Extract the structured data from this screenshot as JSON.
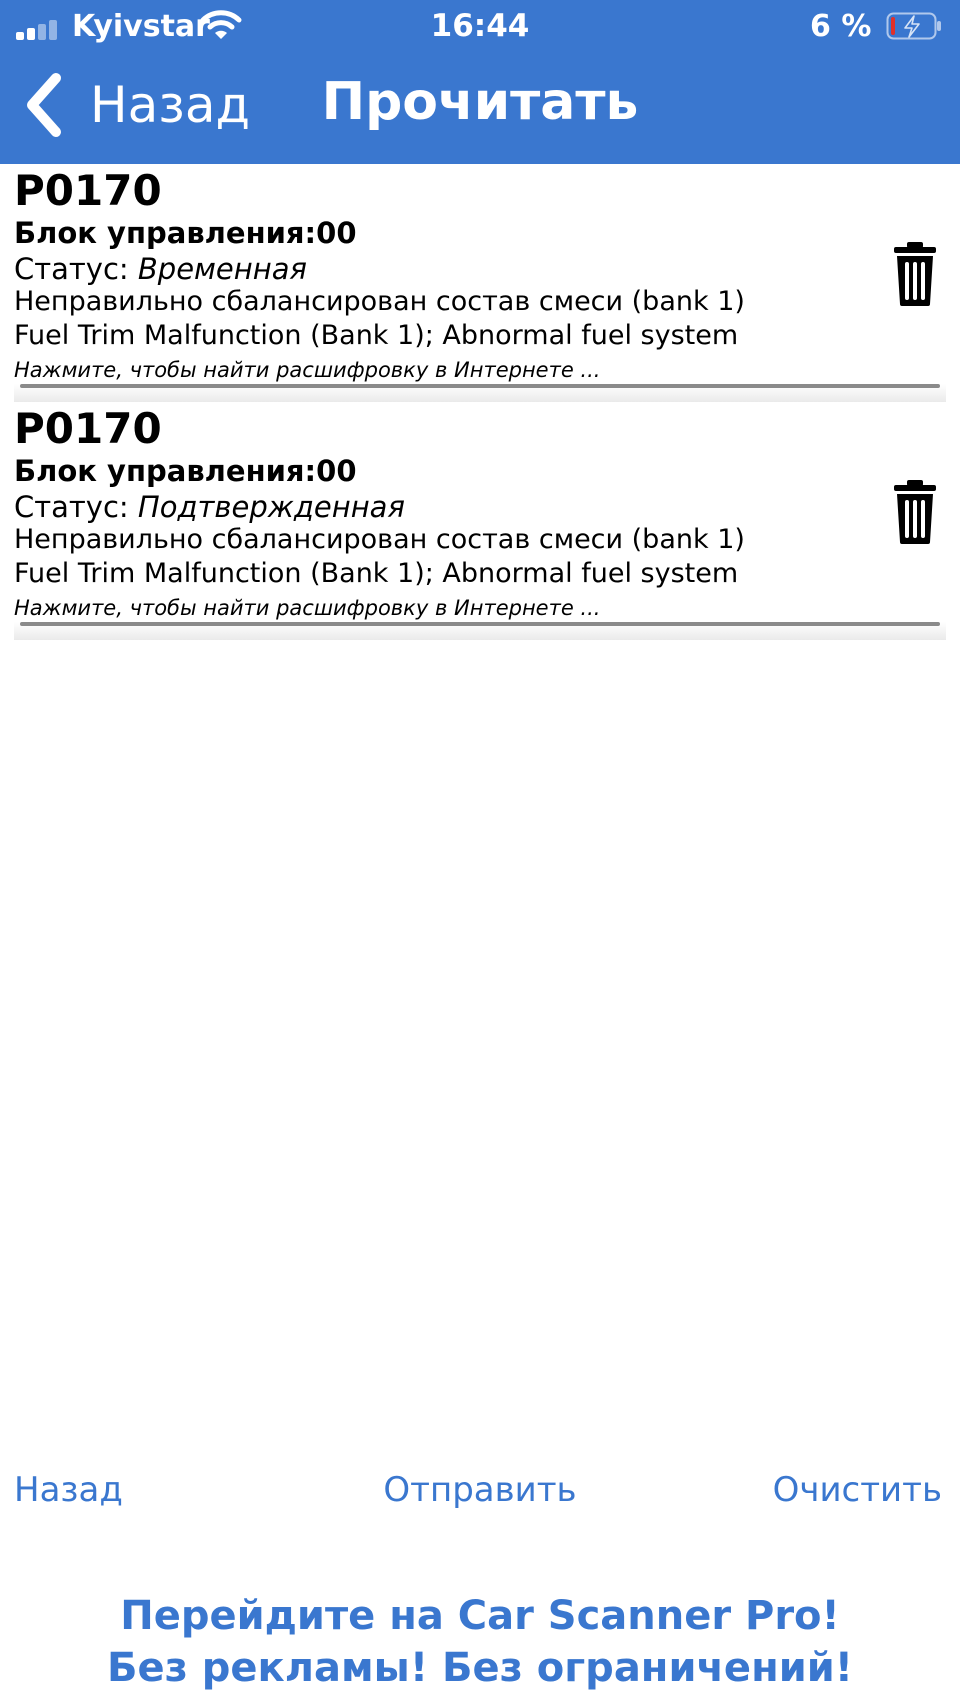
{
  "status_bar": {
    "carrier": "Kyivstar",
    "time": "16:44",
    "battery": "6 %",
    "signal_icon": "signal-bars-icon",
    "wifi_icon": "wifi-icon",
    "battery_icon": "battery-low-icon"
  },
  "nav": {
    "back_label": "Назад",
    "title": "Прочитать"
  },
  "dtcs": [
    {
      "code": "P0170",
      "ecu": "Блок управления:00",
      "status_label": "Статус: ",
      "status_value": "Временная",
      "desc_ru": "Неправильно сбалансирован состав смеси (bank 1)",
      "desc_en": "Fuel Trim Malfunction (Bank 1); Abnormal fuel system",
      "hint": "Нажмите, чтобы найти расшифровку в Интернете ..."
    },
    {
      "code": "P0170",
      "ecu": "Блок управления:00",
      "status_label": "Статус: ",
      "status_value": "Подтвержденная",
      "desc_ru": "Неправильно сбалансирован состав смеси (bank 1)",
      "desc_en": "Fuel Trim Malfunction (Bank 1); Abnormal fuel system",
      "hint": "Нажмите, чтобы найти расшифровку в Интернете ..."
    }
  ],
  "bottom_bar": {
    "back": "Назад",
    "send": "Отправить",
    "clear": "Очистить"
  },
  "promo": {
    "line1": "Перейдите на Car Scanner Pro!",
    "line2": "Без рекламы! Без ограничений!"
  },
  "colors": {
    "accent": "#3a77cf",
    "battery_low": "#e0302a"
  }
}
